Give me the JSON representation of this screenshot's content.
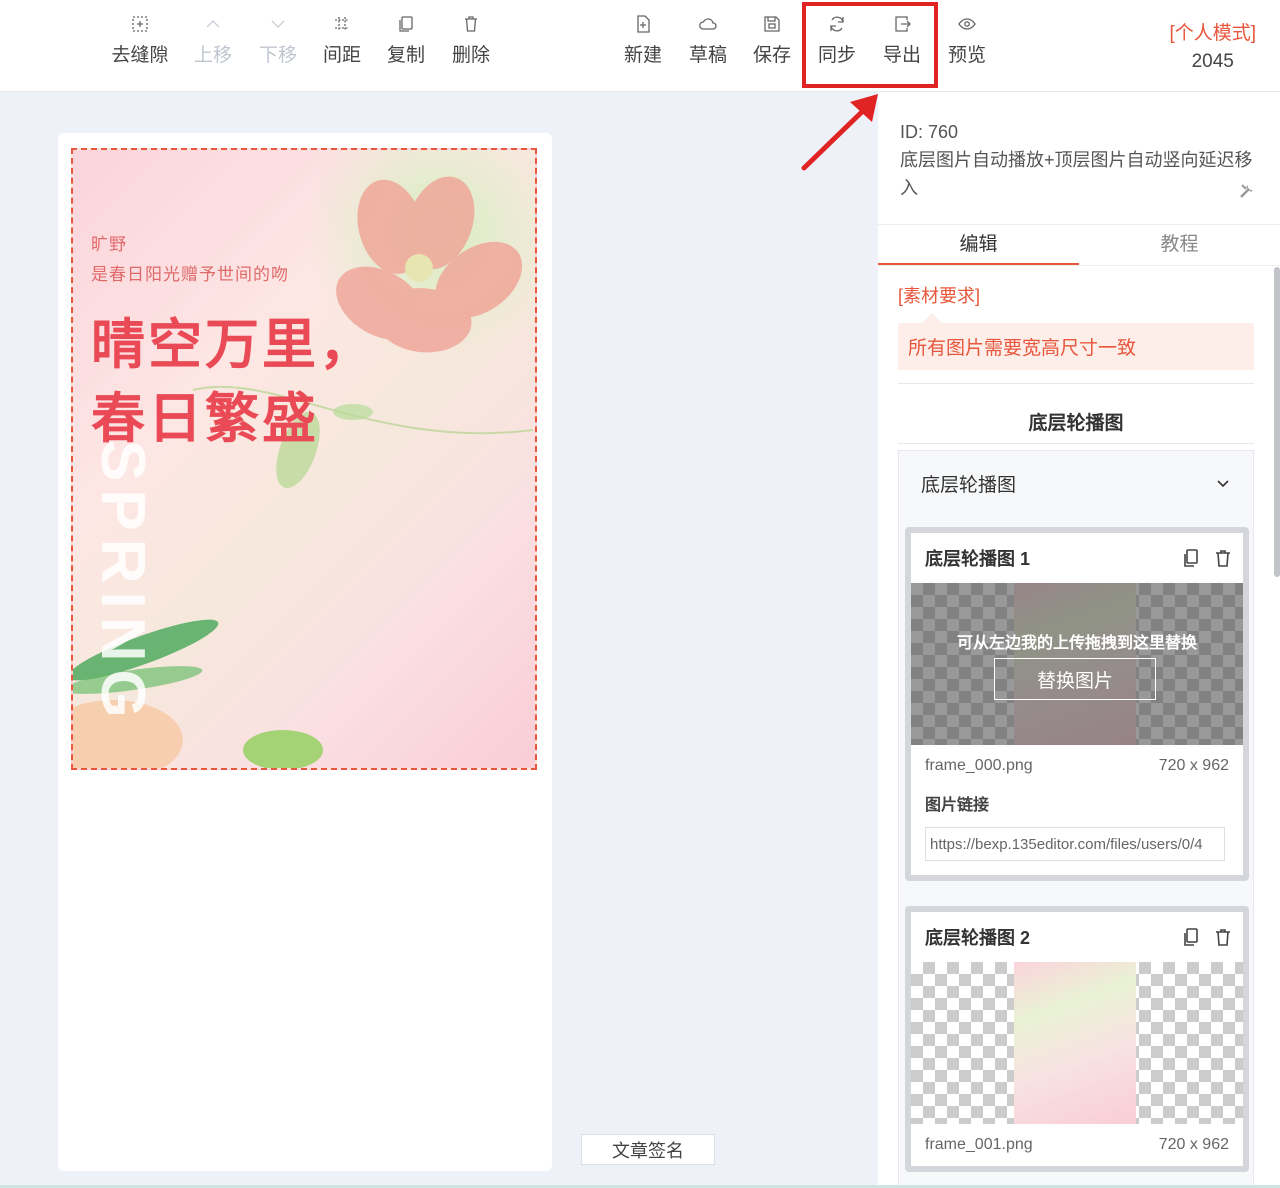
{
  "toolbar": {
    "left": [
      {
        "label": "去缝隙",
        "icon": "gap-icon",
        "disabled": false
      },
      {
        "label": "上移",
        "icon": "chevron-up-icon",
        "disabled": true
      },
      {
        "label": "下移",
        "icon": "chevron-down-icon",
        "disabled": true
      },
      {
        "label": "间距",
        "icon": "spacing-icon",
        "disabled": false
      },
      {
        "label": "复制",
        "icon": "copy-icon",
        "disabled": false
      },
      {
        "label": "删除",
        "icon": "trash-icon",
        "disabled": false
      }
    ],
    "right": [
      {
        "label": "新建",
        "icon": "new-file-icon"
      },
      {
        "label": "草稿",
        "icon": "cloud-icon"
      },
      {
        "label": "保存",
        "icon": "save-icon"
      },
      {
        "label": "同步",
        "icon": "sync-icon"
      },
      {
        "label": "导出",
        "icon": "export-icon"
      },
      {
        "label": "预览",
        "icon": "eye-icon"
      }
    ],
    "mode_label": "[个人模式]",
    "mode_number": "2045"
  },
  "poster": {
    "small_line1": "旷野",
    "small_line2": "是春日阳光赠予世间的吻",
    "big_line1": "晴空万里，",
    "big_line2": "春日繁盛",
    "vertical_word": "SPRING"
  },
  "canvas": {
    "sign_button": "文章签名"
  },
  "panel": {
    "id_text": "ID: 760",
    "desc": "底层图片自动播放+顶层图片自动竖向延迟移入",
    "tabs": [
      "编辑",
      "教程"
    ],
    "requirement_title": "[素材要求]",
    "requirement_text": "所有图片需要宽高尺寸一致",
    "section_title": "底层轮播图",
    "collapse_title": "底层轮播图",
    "cards": [
      {
        "title": "底层轮播图 1",
        "hint": "可从左边我的上传拖拽到这里替换",
        "replace_label": "替换图片",
        "filename": "frame_000.png",
        "size": "720 x 962",
        "link_label": "图片链接",
        "link_value": "https://bexp.135editor.com/files/users/0/4"
      },
      {
        "title": "底层轮播图 2",
        "filename": "frame_001.png",
        "size": "720 x 962"
      }
    ]
  },
  "colors": {
    "accent": "#e8573c",
    "highlight": "#e02424",
    "poster_title": "#e94a55"
  }
}
